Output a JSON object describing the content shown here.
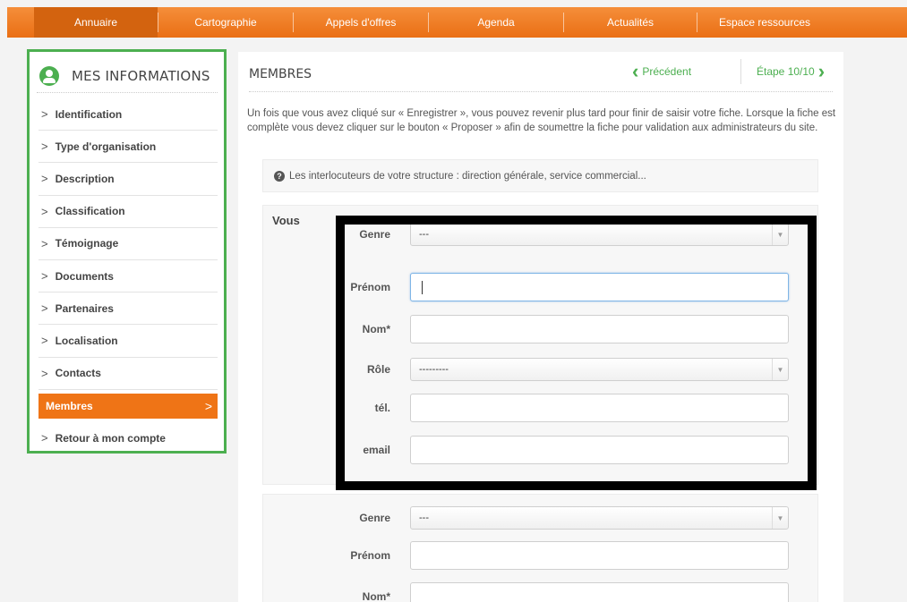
{
  "nav": {
    "items": [
      {
        "label": "Annuaire"
      },
      {
        "label": "Cartographie"
      },
      {
        "label": "Appels d'offres"
      },
      {
        "label": "Agenda"
      },
      {
        "label": "Actualités"
      },
      {
        "label": "Espace ressources"
      }
    ],
    "active_index": 0
  },
  "sidebar": {
    "title": "MES INFORMATIONS",
    "items": [
      {
        "label": "Identification"
      },
      {
        "label": "Type d'organisation"
      },
      {
        "label": "Description"
      },
      {
        "label": "Classification"
      },
      {
        "label": "Témoignage"
      },
      {
        "label": "Documents"
      },
      {
        "label": "Partenaires"
      },
      {
        "label": "Localisation"
      },
      {
        "label": "Contacts"
      },
      {
        "label": "Membres"
      },
      {
        "label": "Retour à mon compte"
      }
    ],
    "active_label": "Membres"
  },
  "main": {
    "title": "MEMBRES",
    "prev_label": "Précédent",
    "step_label": "Étape 10/10",
    "intro": "Un fois que vous avez cliqué sur « Enregistrer », vous pouvez revenir plus tard pour finir de saisir votre fiche. Lorsque la fiche est complète vous devez cliquer sur le bouton « Proposer » afin de soumettre la fiche pour validation aux administrateurs du site.",
    "info": "Les interlocuteurs de votre structure : direction générale, service commercial..."
  },
  "card1": {
    "title": "Vous",
    "genre_label": "Genre",
    "genre_value": "---",
    "prenom_label": "Prénom",
    "prenom_value": "",
    "nom_label": "Nom*",
    "nom_value": "",
    "role_label": "Rôle",
    "role_value": "---------",
    "tel_label": "tél.",
    "tel_value": "",
    "email_label": "email",
    "email_value": ""
  },
  "card2": {
    "genre_label": "Genre",
    "genre_value": "---",
    "prenom_label": "Prénom",
    "prenom_value": "",
    "nom_label": "Nom*",
    "nom_value": ""
  },
  "colors": {
    "accent": "#ef7416",
    "nav_bg": "#f0801f",
    "sidebar_border": "#4caf50",
    "link_green": "#4caf50"
  }
}
